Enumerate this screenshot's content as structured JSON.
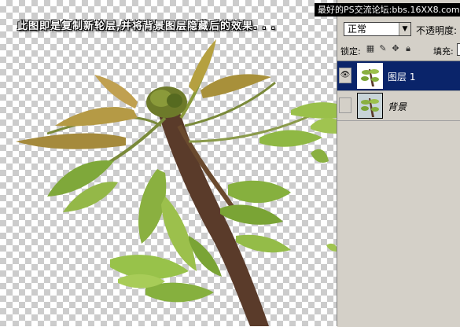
{
  "canvas": {
    "caption": "此图即是复制新轮层,并将背景图层隐藏后的效果. . ."
  },
  "watermark": {
    "text": "最好的PS交流论坛:bbs.16XX8.com"
  },
  "layers_panel": {
    "blend_mode": "正常",
    "opacity_label": "不透明度:",
    "lock_label": "锁定:",
    "fill_label": "填充:",
    "lock_icons": [
      "lock-transparent-icon",
      "lock-brush-icon",
      "lock-move-icon",
      "lock-all-icon"
    ],
    "layers": [
      {
        "name": "图层 1",
        "selected": true,
        "visible": true
      },
      {
        "name": "背景",
        "selected": false,
        "visible": false
      }
    ]
  },
  "colors": {
    "panel_bg": "#d4d0c8",
    "selection": "#0a246a",
    "checker": "#cccccc"
  }
}
